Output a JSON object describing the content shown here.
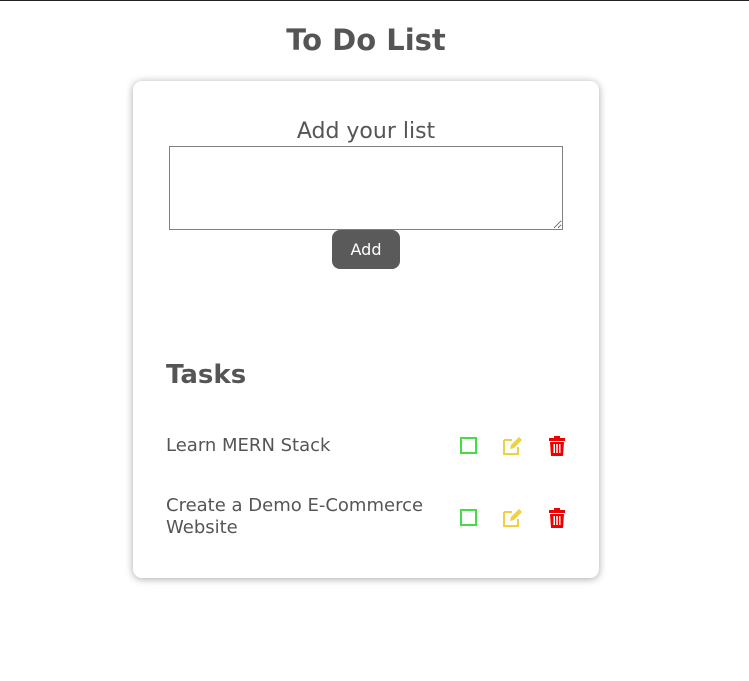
{
  "page": {
    "title": "To Do List"
  },
  "form": {
    "label": "Add your list",
    "input_value": "",
    "add_label": "Add"
  },
  "tasks": {
    "heading": "Tasks",
    "items": [
      {
        "text": "Learn MERN Stack"
      },
      {
        "text": "Create a Demo E-Commerce Website"
      }
    ]
  },
  "icons": {
    "complete": "square-outline-icon",
    "edit": "edit-icon",
    "delete": "trash-icon"
  },
  "colors": {
    "text": "#555555",
    "button_bg": "#5a5a5a",
    "complete_icon": "#44dd44",
    "edit_icon": "#f0d040",
    "delete_icon": "#ee0000"
  }
}
